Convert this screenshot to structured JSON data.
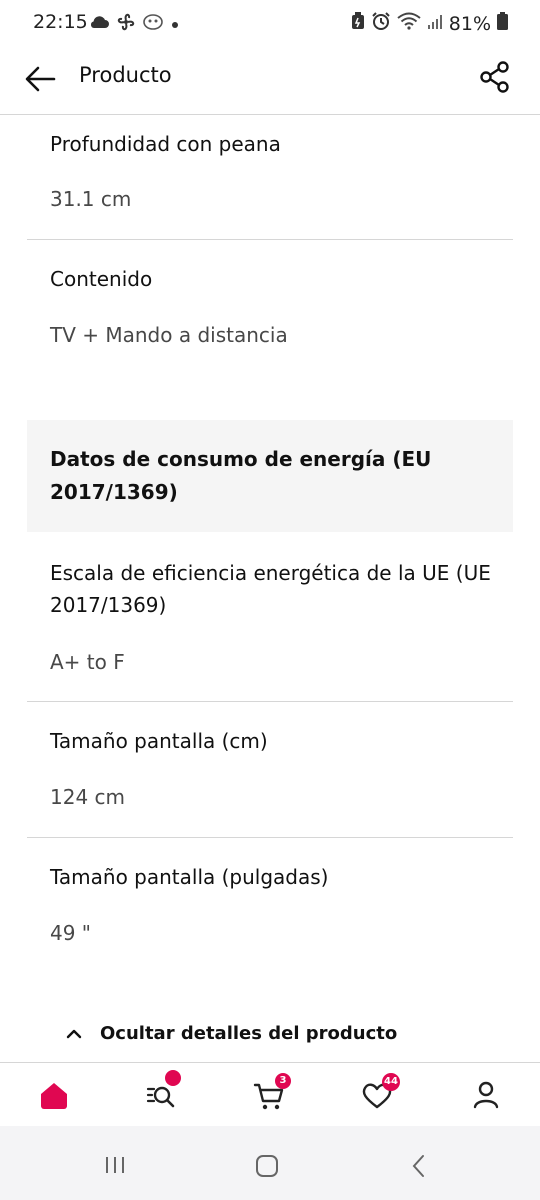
{
  "status_bar": {
    "time": "22:15",
    "battery": "81%",
    "left_icons": [
      "cloud-icon",
      "fan-icon",
      "mask-icon",
      "dot-icon"
    ],
    "right_icons": [
      "battery-saver-icon",
      "alarm-icon",
      "wifi-icon",
      "signal-icon",
      "battery-icon"
    ]
  },
  "header": {
    "title": "Producto",
    "back_icon": "arrow-left-icon",
    "share_icon": "share-icon"
  },
  "specs": [
    {
      "label": "Profundidad con peana",
      "value": "31.1 cm"
    },
    {
      "label": "Contenido",
      "value": "TV + Mando a distancia"
    }
  ],
  "energy_section": {
    "title": "Datos de consumo de energía (EU 2017/1369)",
    "items": [
      {
        "label": "Escala de eficiencia energética de la UE (UE 2017/1369)",
        "value": "A+ to F"
      },
      {
        "label": "Tamaño pantalla (cm)",
        "value": "124 cm"
      },
      {
        "label": "Tamaño pantalla (pulgadas)",
        "value": "49 \""
      }
    ]
  },
  "toggle_details": {
    "label": "Ocultar detalles del producto",
    "icon": "chevron-up-icon"
  },
  "bottom_nav": {
    "items": [
      {
        "name": "home",
        "icon": "home-icon",
        "active": true
      },
      {
        "name": "search",
        "icon": "search-icon",
        "badge": ""
      },
      {
        "name": "cart",
        "icon": "cart-icon",
        "badge": "3"
      },
      {
        "name": "wishlist",
        "icon": "heart-icon",
        "badge": "44"
      },
      {
        "name": "profile",
        "icon": "person-icon"
      }
    ]
  },
  "colors": {
    "accent_red": "#e00751",
    "divider": "#d6d6d6",
    "section_bg": "#f5f5f5",
    "text_primary": "#111111",
    "text_secondary": "#484848"
  }
}
